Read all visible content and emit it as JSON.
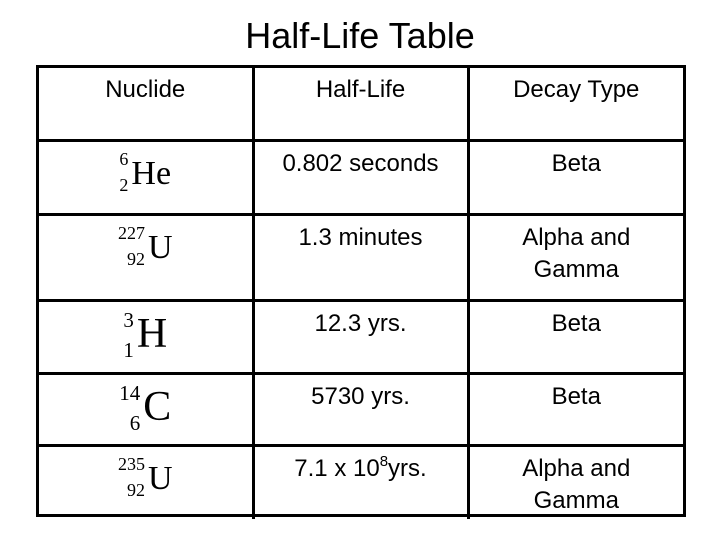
{
  "title": "Half-Life Table",
  "table": {
    "headers": [
      "Nuclide",
      "Half-Life",
      "Decay Type"
    ],
    "rows": [
      {
        "nuclide": {
          "mass": "6",
          "atomic": "2",
          "symbol": "He"
        },
        "half_life": "0.802 seconds",
        "decay_type": [
          "Beta"
        ]
      },
      {
        "nuclide": {
          "mass": "227",
          "atomic": "92",
          "symbol": "U"
        },
        "half_life": "1.3 minutes",
        "decay_type": [
          "Alpha and",
          "Gamma"
        ]
      },
      {
        "nuclide": {
          "mass": "3",
          "atomic": "1",
          "symbol": "H"
        },
        "half_life": "12.3 yrs.",
        "decay_type": [
          "Beta"
        ]
      },
      {
        "nuclide": {
          "mass": "14",
          "atomic": "6",
          "symbol": "C"
        },
        "half_life": "5730 yrs.",
        "decay_type": [
          "Beta"
        ]
      },
      {
        "nuclide": {
          "mass": "235",
          "atomic": "92",
          "symbol": "U"
        },
        "half_life_base": "7.1 x 10",
        "half_life_exponent": "8",
        "half_life_unit": "yrs.",
        "decay_type": [
          "Alpha and",
          "Gamma"
        ]
      }
    ]
  }
}
